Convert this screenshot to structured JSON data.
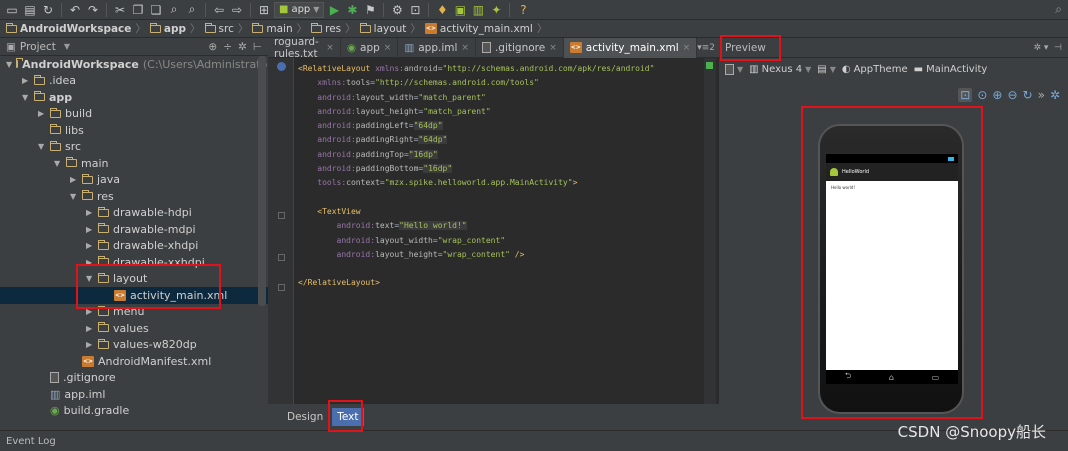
{
  "toolbar": {
    "run_config": "app",
    "icons": [
      "open-folder-icon",
      "save-icon",
      "sync-icon",
      "undo-icon",
      "redo-icon",
      "cut-icon",
      "copy-icon",
      "paste-icon",
      "find-icon",
      "replace-icon",
      "back-icon",
      "forward-icon",
      "make-icon",
      "run-icon",
      "debug-icon",
      "attach-icon",
      "sdk-manager-icon",
      "avd-manager-icon",
      "android-device-icon",
      "help-icon",
      "search-icon"
    ]
  },
  "breadcrumbs": [
    "AndroidWorkspace",
    "app",
    "src",
    "main",
    "res",
    "layout",
    "activity_main.xml"
  ],
  "project_panel": {
    "title": "Project",
    "tree": [
      {
        "indent": 0,
        "arrow": "▼",
        "icon": "module",
        "label": "AndroidWorkspace",
        "suffix": "(C:\\Users\\Administrator\\Doc",
        "bold": true
      },
      {
        "indent": 1,
        "arrow": "▶",
        "icon": "folder",
        "label": ".idea"
      },
      {
        "indent": 1,
        "arrow": "▼",
        "icon": "module",
        "label": "app",
        "bold": true
      },
      {
        "indent": 2,
        "arrow": "▶",
        "icon": "folder",
        "label": "build"
      },
      {
        "indent": 2,
        "arrow": "",
        "icon": "folder",
        "label": "libs"
      },
      {
        "indent": 2,
        "arrow": "▼",
        "icon": "folder",
        "label": "src"
      },
      {
        "indent": 3,
        "arrow": "▼",
        "icon": "folder",
        "label": "main"
      },
      {
        "indent": 4,
        "arrow": "▶",
        "icon": "folder",
        "label": "java"
      },
      {
        "indent": 4,
        "arrow": "▼",
        "icon": "folder",
        "label": "res"
      },
      {
        "indent": 5,
        "arrow": "▶",
        "icon": "folder",
        "label": "drawable-hdpi"
      },
      {
        "indent": 5,
        "arrow": "▶",
        "icon": "folder",
        "label": "drawable-mdpi"
      },
      {
        "indent": 5,
        "arrow": "▶",
        "icon": "folder",
        "label": "drawable-xhdpi"
      },
      {
        "indent": 5,
        "arrow": "▶",
        "icon": "folder",
        "label": "drawable-xxhdpi"
      },
      {
        "indent": 5,
        "arrow": "▼",
        "icon": "folder",
        "label": "layout"
      },
      {
        "indent": 6,
        "arrow": "",
        "icon": "xml",
        "label": "activity_main.xml",
        "selected": true
      },
      {
        "indent": 5,
        "arrow": "▶",
        "icon": "folder",
        "label": "menu"
      },
      {
        "indent": 5,
        "arrow": "▶",
        "icon": "folder",
        "label": "values"
      },
      {
        "indent": 5,
        "arrow": "▶",
        "icon": "folder",
        "label": "values-w820dp"
      },
      {
        "indent": 4,
        "arrow": "",
        "icon": "xml",
        "label": "AndroidManifest.xml"
      },
      {
        "indent": 2,
        "arrow": "",
        "icon": "file",
        "label": ".gitignore"
      },
      {
        "indent": 2,
        "arrow": "",
        "icon": "iml",
        "label": "app.iml"
      },
      {
        "indent": 2,
        "arrow": "",
        "icon": "gradle",
        "label": "build.gradle"
      }
    ]
  },
  "editor_tabs": [
    {
      "label": "roguard-rules.txt",
      "icon": ""
    },
    {
      "label": "app",
      "icon": "gradle"
    },
    {
      "label": "app.iml",
      "icon": "iml"
    },
    {
      "label": ".gitignore",
      "icon": "file"
    },
    {
      "label": "activity_main.xml",
      "icon": "xml",
      "active": true
    }
  ],
  "tabs_overflow": "▾≡2",
  "code_lines": [
    [
      [
        "c-tag",
        "<RelativeLayout "
      ],
      [
        "c-ns",
        "xmlns:"
      ],
      [
        "c-attr",
        "android"
      ],
      [
        "",
        "="
      ],
      [
        "c-val",
        "\"http://schemas.android.com/apk/res/android\""
      ]
    ],
    [
      [
        "",
        "    "
      ],
      [
        "c-ns",
        "xmlns:"
      ],
      [
        "c-attr",
        "tools"
      ],
      [
        "",
        "="
      ],
      [
        "c-val",
        "\"http://schemas.android.com/tools\""
      ]
    ],
    [
      [
        "",
        "    "
      ],
      [
        "c-ns",
        "android:"
      ],
      [
        "c-attr",
        "layout_width"
      ],
      [
        "",
        "="
      ],
      [
        "c-val",
        "\"match_parent\""
      ]
    ],
    [
      [
        "",
        "    "
      ],
      [
        "c-ns",
        "android:"
      ],
      [
        "c-attr",
        "layout_height"
      ],
      [
        "",
        "="
      ],
      [
        "c-val",
        "\"match_parent\""
      ]
    ],
    [
      [
        "",
        "    "
      ],
      [
        "c-ns",
        "android:"
      ],
      [
        "c-attr",
        "paddingLeft"
      ],
      [
        "",
        "="
      ],
      [
        "c-val-hl",
        "\"64dp\""
      ]
    ],
    [
      [
        "",
        "    "
      ],
      [
        "c-ns",
        "android:"
      ],
      [
        "c-attr",
        "paddingRight"
      ],
      [
        "",
        "="
      ],
      [
        "c-val-hl",
        "\"64dp\""
      ]
    ],
    [
      [
        "",
        "    "
      ],
      [
        "c-ns",
        "android:"
      ],
      [
        "c-attr",
        "paddingTop"
      ],
      [
        "",
        "="
      ],
      [
        "c-val-hl",
        "\"16dp\""
      ]
    ],
    [
      [
        "",
        "    "
      ],
      [
        "c-ns",
        "android:"
      ],
      [
        "c-attr",
        "paddingBottom"
      ],
      [
        "",
        "="
      ],
      [
        "c-val-hl",
        "\"16dp\""
      ]
    ],
    [
      [
        "",
        "    "
      ],
      [
        "c-ns",
        "tools:"
      ],
      [
        "c-attr",
        "context"
      ],
      [
        "",
        "="
      ],
      [
        "c-val",
        "\"mzx.spike.helloworld.app.MainActivity\""
      ],
      [
        "c-tag",
        ">"
      ]
    ],
    [
      [
        "",
        ""
      ]
    ],
    [
      [
        "",
        "    "
      ],
      [
        "c-tag",
        "<TextView"
      ]
    ],
    [
      [
        "",
        "        "
      ],
      [
        "c-ns",
        "android:"
      ],
      [
        "c-attr",
        "text"
      ],
      [
        "",
        "="
      ],
      [
        "c-val-hl",
        "\"Hello world!\""
      ]
    ],
    [
      [
        "",
        "        "
      ],
      [
        "c-ns",
        "android:"
      ],
      [
        "c-attr",
        "layout_width"
      ],
      [
        "",
        "="
      ],
      [
        "c-val",
        "\"wrap_content\""
      ]
    ],
    [
      [
        "",
        "        "
      ],
      [
        "c-ns",
        "android:"
      ],
      [
        "c-attr",
        "layout_height"
      ],
      [
        "",
        "="
      ],
      [
        "c-val",
        "\"wrap_content\""
      ],
      [
        "c-tag",
        " />"
      ]
    ],
    [
      [
        "",
        ""
      ]
    ],
    [
      [
        "c-tag",
        "</RelativeLayout>"
      ]
    ]
  ],
  "bottom_tabs": [
    "Design",
    "Text"
  ],
  "preview": {
    "title": "Preview",
    "device": "Nexus 4",
    "theme": "AppTheme",
    "activity": "MainActivity",
    "app_title": "HelloWorld",
    "app_text": "Hello world!"
  },
  "statusbar": {
    "label": "Event Log"
  },
  "watermark": "CSDN @Snoopy船长",
  "accent_colors": {
    "highlight_box": "#e0131a",
    "selection": "#0d293e",
    "active_tab": "#4b6eaf"
  }
}
